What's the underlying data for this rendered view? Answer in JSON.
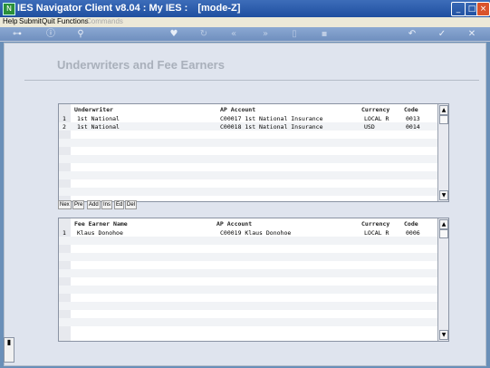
{
  "app": {
    "title": "IES Navigator Client v8.04 : My IES :",
    "mode": "[mode-Z]",
    "icon_glyph": "N"
  },
  "menu": {
    "items": [
      "Help",
      "Submit",
      "Quit",
      "Functions"
    ],
    "disabled_item": "Commands"
  },
  "page": {
    "title": "Underwriters and Fee Earners"
  },
  "underwriters": {
    "headers": [
      "Underwriter",
      "AP Account",
      "Currency",
      "Code"
    ],
    "rows": [
      {
        "num": "1",
        "underwriter": "1st National",
        "ap_account": "C00017 1st National Insurance",
        "currency": "LOCAL R",
        "code": "0013"
      },
      {
        "num": "2",
        "underwriter": "1st National",
        "ap_account": "C00018 1st National Insurance",
        "currency": "USD",
        "code": "0014"
      }
    ],
    "buttons": [
      "Nex",
      "Pre",
      "Add",
      "Ins",
      "Ed",
      "Del"
    ]
  },
  "fee_earners": {
    "headers": [
      "Fee Earner Name",
      "AP Account",
      "Currency",
      "Code"
    ],
    "rows": [
      {
        "num": "1",
        "name": "Klaus Donohoe",
        "ap_account": "C00019 Klaus Donohoe",
        "currency": "LOCAL R",
        "code": "0006"
      }
    ]
  },
  "icons": {
    "toolbar": [
      "key-icon",
      "info-icon",
      "search-icon",
      "heart-icon",
      "refresh-icon",
      "rewind-icon",
      "fast-forward-icon",
      "document-icon",
      "save-icon",
      "back-icon",
      "check-icon",
      "close-icon"
    ]
  },
  "colors": {
    "titlebar": "#1f4fa0",
    "toolbar": "#7a98c6",
    "workspace": "#dfe4ee",
    "page_title": "#a9b0bb"
  }
}
